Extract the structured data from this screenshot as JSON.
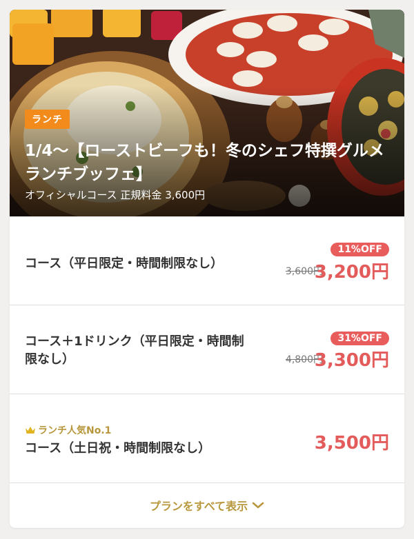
{
  "hero": {
    "badge": "ランチ",
    "title": "1/4〜【ローストビーフも！冬のシェフ特撰グルメランチブッフェ】",
    "subtitle": "オフィシャルコース 正規料金 3,600円"
  },
  "plans": [
    {
      "name": "コース（平日限定・時間制限なし）",
      "discount": "11%OFF",
      "old_price": "3,600円",
      "price": "3,200円"
    },
    {
      "name": "コース＋1ドリンク（平日限定・時間制限なし）",
      "discount": "31%OFF",
      "old_price": "4,800円",
      "price": "3,300円"
    },
    {
      "popular_label": "ランチ人気No.1",
      "name": "コース（土日祝・時間制限なし）",
      "price": "3,500円"
    }
  ],
  "show_all": {
    "label": "プランをすべて表示"
  },
  "colors": {
    "badge": "#f28b1c",
    "discount": "#e85c5c",
    "price": "#e35b5b",
    "gold": "#b8973c"
  }
}
